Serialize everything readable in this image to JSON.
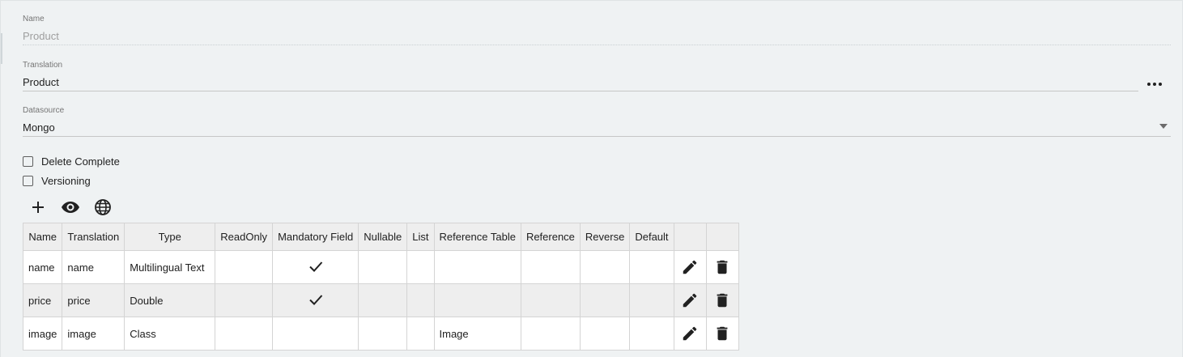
{
  "form": {
    "name": {
      "label": "Name",
      "value": "Product"
    },
    "translation": {
      "label": "Translation",
      "value": "Product",
      "more_icon": "more-horizontal-icon"
    },
    "datasource": {
      "label": "Datasource",
      "value": "Mongo",
      "arrow_icon": "dropdown-arrow-icon"
    },
    "checkboxes": [
      {
        "label": "Delete Complete",
        "checked": false
      },
      {
        "label": "Versioning",
        "checked": false
      }
    ]
  },
  "toolbar": {
    "buttons": [
      {
        "icon": "plus-icon"
      },
      {
        "icon": "eye-icon"
      },
      {
        "icon": "globe-icon"
      }
    ]
  },
  "table": {
    "columns": [
      "Name",
      "Translation",
      "Type",
      "ReadOnly",
      "Mandatory Field",
      "Nullable",
      "List",
      "Reference Table",
      "Reference",
      "Reverse",
      "Default",
      "",
      ""
    ],
    "rows": [
      {
        "name": "name",
        "translation": "name",
        "type": "Multilingual Text",
        "readonly": "",
        "mandatory": true,
        "nullable": "",
        "list": "",
        "reference_table": "",
        "reference": "",
        "reverse": "",
        "default": ""
      },
      {
        "name": "price",
        "translation": "price",
        "type": "Double",
        "readonly": "",
        "mandatory": true,
        "nullable": "",
        "list": "",
        "reference_table": "",
        "reference": "",
        "reverse": "",
        "default": ""
      },
      {
        "name": "image",
        "translation": "image",
        "type": "Class",
        "readonly": "",
        "mandatory": false,
        "nullable": "",
        "list": "",
        "reference_table": "Image",
        "reference": "",
        "reverse": "",
        "default": ""
      }
    ],
    "row_icons": {
      "edit": "pencil-icon",
      "delete": "trash-icon",
      "check": "checkmark-icon"
    }
  }
}
